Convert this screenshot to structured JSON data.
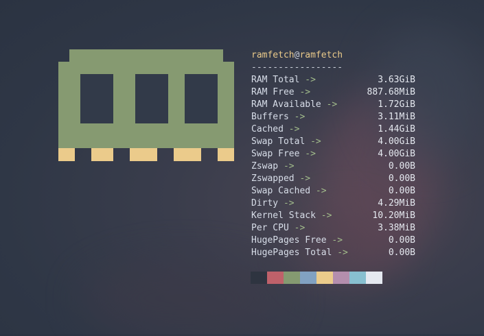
{
  "header": {
    "user": "ramfetch",
    "at": "@",
    "host": "ramfetch",
    "separator": "-----------------"
  },
  "rows": [
    {
      "key": "RAM Total",
      "arrow": "->",
      "value": "3.63GiB"
    },
    {
      "key": "RAM Free",
      "arrow": "->",
      "value": "887.68MiB"
    },
    {
      "key": "RAM Available",
      "arrow": "->",
      "value": "1.72GiB"
    },
    {
      "key": "Buffers",
      "arrow": "->",
      "value": "3.11MiB"
    },
    {
      "key": "Cached",
      "arrow": "->",
      "value": "1.44GiB"
    },
    {
      "key": "Swap Total",
      "arrow": "->",
      "value": "4.00GiB"
    },
    {
      "key": "Swap Free",
      "arrow": "->",
      "value": "4.00GiB"
    },
    {
      "key": "Zswap",
      "arrow": "->",
      "value": "0.00B"
    },
    {
      "key": "Zswapped",
      "arrow": "->",
      "value": "0.00B"
    },
    {
      "key": "Swap Cached",
      "arrow": "->",
      "value": "0.00B"
    },
    {
      "key": "Dirty",
      "arrow": "->",
      "value": "4.29MiB"
    },
    {
      "key": "Kernel Stack",
      "arrow": "->",
      "value": "10.20MiB"
    },
    {
      "key": "Per CPU",
      "arrow": "->",
      "value": "3.38MiB"
    },
    {
      "key": "HugePages Free",
      "arrow": "->",
      "value": "0.00B"
    },
    {
      "key": "HugePages Total",
      "arrow": "->",
      "value": "0.00B"
    }
  ],
  "colors": {
    "logo_body": "#869a71",
    "logo_contacts": "#ebcb8b",
    "palette": [
      "#2e3440",
      "#bf616a",
      "#859a71",
      "#81a1c1",
      "#ebcb8b",
      "#b48ead",
      "#88c0d0",
      "#e5e9f0"
    ]
  },
  "logo": {
    "name": "ram-module-icon"
  }
}
